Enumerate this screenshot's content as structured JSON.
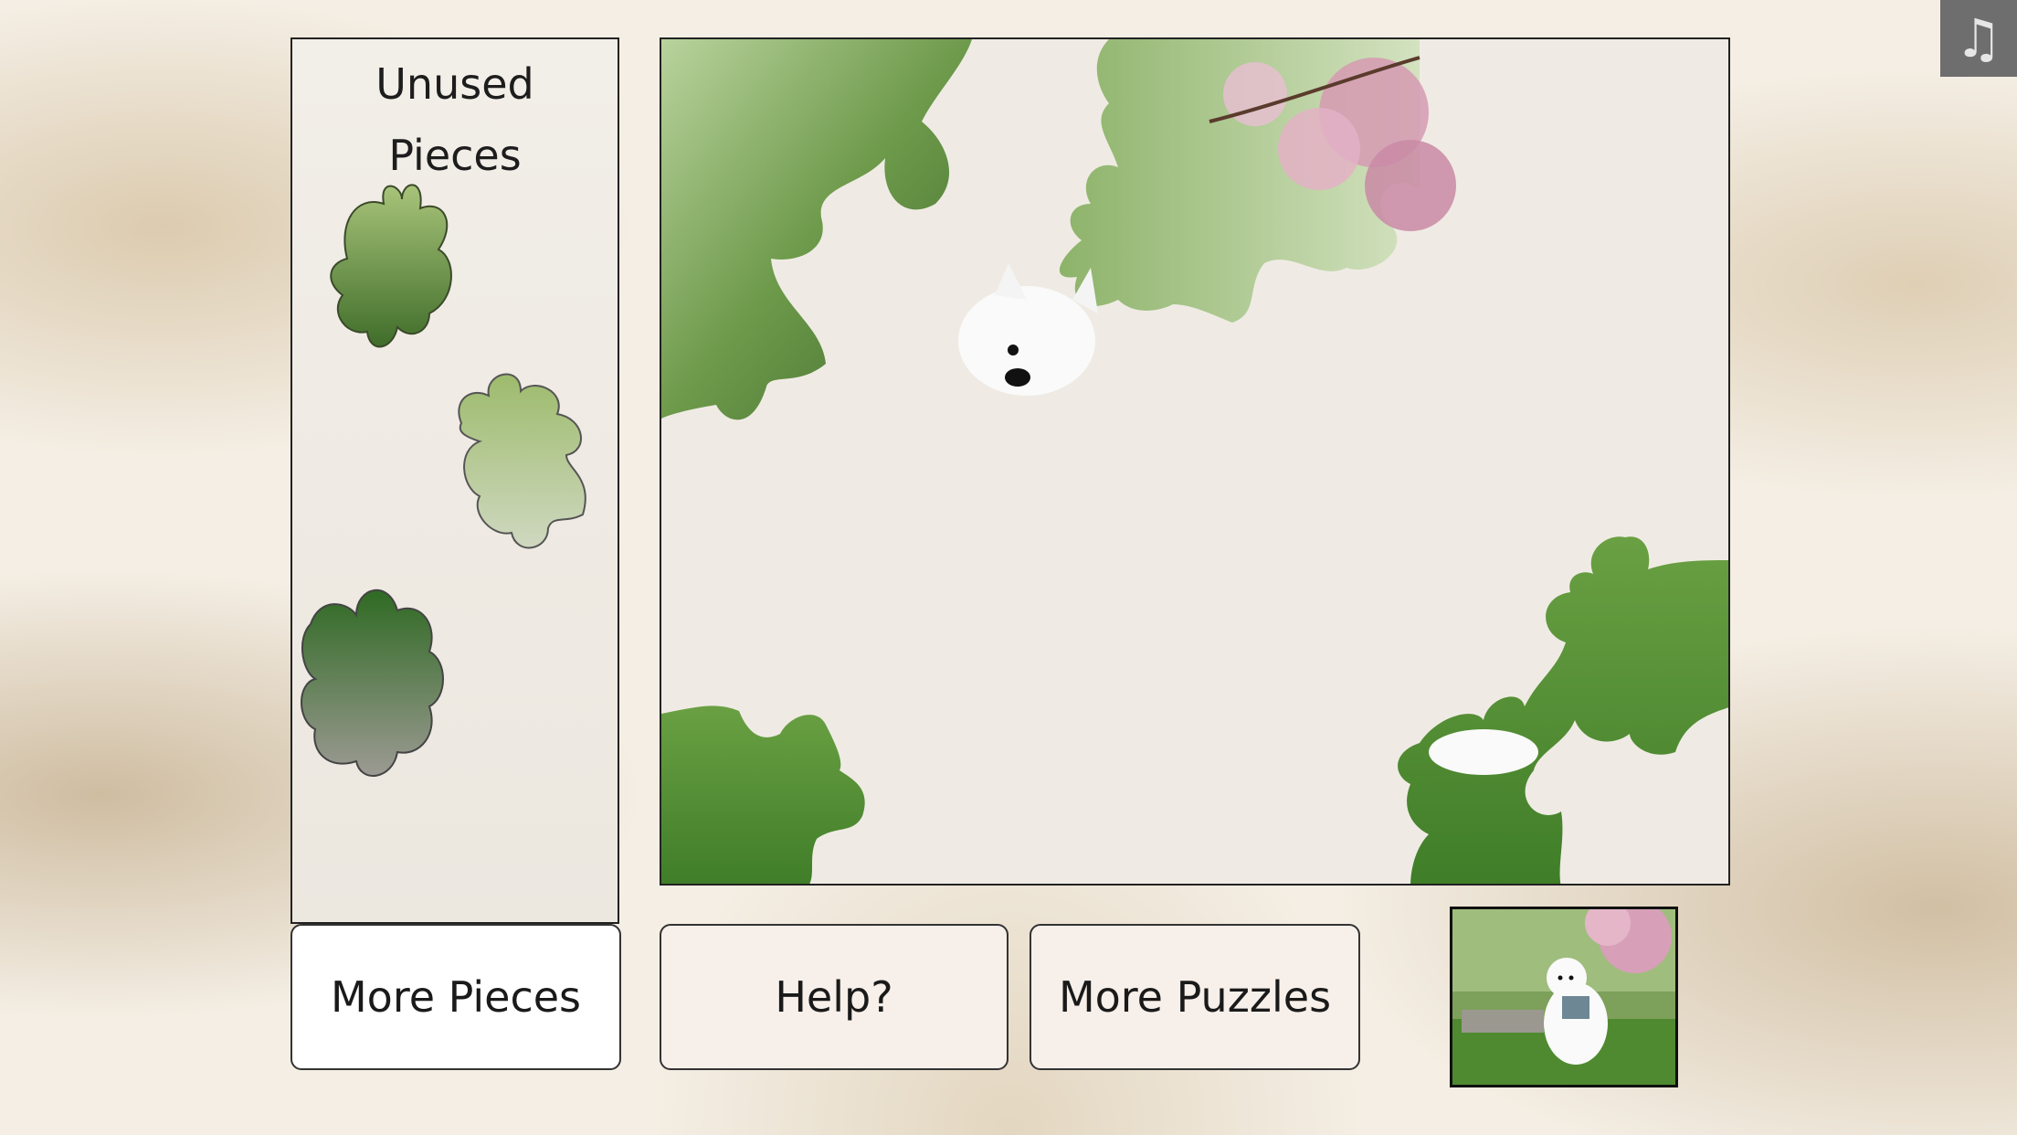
{
  "panel": {
    "title_line1": "Unused",
    "title_line2": "Pieces"
  },
  "buttons": {
    "more_pieces": "More Pieces",
    "help": "Help?",
    "more_puzzles": "More Puzzles"
  },
  "icons": {
    "music": "music-note-icon"
  },
  "colors": {
    "grass": "#4c8a2e",
    "foliage": "#7aa35a",
    "blossom": "#d89ab3",
    "board_bg": "#efebe4"
  }
}
